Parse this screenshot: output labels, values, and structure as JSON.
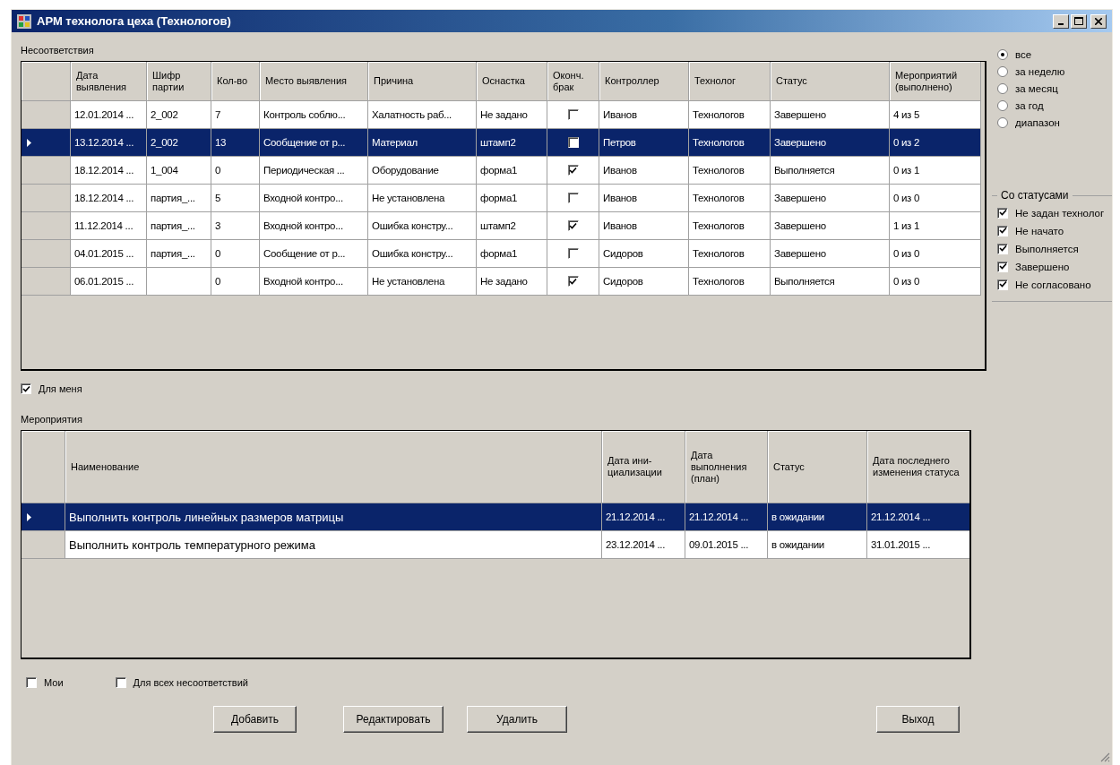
{
  "window": {
    "title": "АРМ технолога цеха (Технологов)"
  },
  "nonconformities": {
    "label": "Несоответствия",
    "columns": [
      "Дата выявления",
      "Шифр партии",
      "Кол-во",
      "Место выявления",
      "Причина",
      "Оснастка",
      "Оконч. брак",
      "Контроллер",
      "Технолог",
      "Статус",
      "Мероприятий (выполнено)"
    ],
    "rows": [
      {
        "selected": false,
        "cells": [
          "12.01.2014 ...",
          "2_002",
          "7",
          "Контроль соблю...",
          "Халатность раб...",
          "Не задано",
          {
            "checked": false
          },
          "Иванов",
          "Технологов",
          "Завершено",
          "4 из 5"
        ]
      },
      {
        "selected": true,
        "cells": [
          "13.12.2014 ...",
          "2_002",
          "13",
          "Сообщение от р...",
          "Материал",
          "штамп2",
          {
            "checked": false
          },
          "Петров",
          "Технологов",
          "Завершено",
          "0 из 2"
        ]
      },
      {
        "selected": false,
        "cells": [
          "18.12.2014 ...",
          "1_004",
          "0",
          "Периодическая ...",
          "Оборудование",
          "форма1",
          {
            "checked": true
          },
          "Иванов",
          "Технологов",
          "Выполняется",
          "0 из 1"
        ]
      },
      {
        "selected": false,
        "cells": [
          "18.12.2014 ...",
          "партия_...",
          "5",
          "Входной контро...",
          "Не установлена",
          "форма1",
          {
            "checked": false
          },
          "Иванов",
          "Технологов",
          "Завершено",
          "0 из 0"
        ]
      },
      {
        "selected": false,
        "cells": [
          "11.12.2014 ...",
          "партия_...",
          "3",
          "Входной контро...",
          "Ошибка констру...",
          "штамп2",
          {
            "checked": true
          },
          "Иванов",
          "Технологов",
          "Завершено",
          "1 из 1"
        ]
      },
      {
        "selected": false,
        "cells": [
          "04.01.2015 ...",
          "партия_...",
          "0",
          "Сообщение от р...",
          "Ошибка констру...",
          "форма1",
          {
            "checked": false
          },
          "Сидоров",
          "Технологов",
          "Завершено",
          "0 из 0"
        ]
      },
      {
        "selected": false,
        "cells": [
          "06.01.2015 ...",
          "",
          "0",
          "Входной контро...",
          "Не установлена",
          "Не задано",
          {
            "checked": true
          },
          "Сидоров",
          "Технологов",
          "Выполняется",
          "0 из 0"
        ]
      }
    ]
  },
  "period_filter": [
    {
      "label": "все",
      "selected": true
    },
    {
      "label": "за неделю",
      "selected": false
    },
    {
      "label": "за месяц",
      "selected": false
    },
    {
      "label": "за год",
      "selected": false
    },
    {
      "label": "диапазон",
      "selected": false
    }
  ],
  "status_filter": {
    "title": "Со статусами",
    "items": [
      {
        "label": "Не задан технолог",
        "checked": true
      },
      {
        "label": "Не начато",
        "checked": true
      },
      {
        "label": "Выполняется",
        "checked": true
      },
      {
        "label": "Завершено",
        "checked": true
      },
      {
        "label": "Не согласовано",
        "checked": true
      }
    ]
  },
  "for_me": {
    "label": "Для меня",
    "checked": true
  },
  "activities": {
    "label": "Мероприятия",
    "columns": [
      "Наименование",
      "Дата ини-\nциализации",
      "Дата выполнения (план)",
      "Статус",
      "Дата последнего изменения статуса"
    ],
    "rows": [
      {
        "selected": true,
        "cells": [
          "Выполнить контроль линейных размеров матрицы",
          "21.12.2014 ...",
          "21.12.2014 ...",
          "в ожидании",
          "21.12.2014 ..."
        ]
      },
      {
        "selected": false,
        "cells": [
          "Выполнить контроль температурного режима",
          "23.12.2014 ...",
          "09.01.2015 ...",
          "в ожидании",
          "31.01.2015 ..."
        ]
      }
    ]
  },
  "mine": {
    "label": "Мои",
    "checked": false
  },
  "all_nonconformities": {
    "label": "Для всех несоответствий",
    "checked": false
  },
  "buttons": [
    "Добавить",
    "Редактировать",
    "Удалить"
  ],
  "exit_button": "Выход"
}
